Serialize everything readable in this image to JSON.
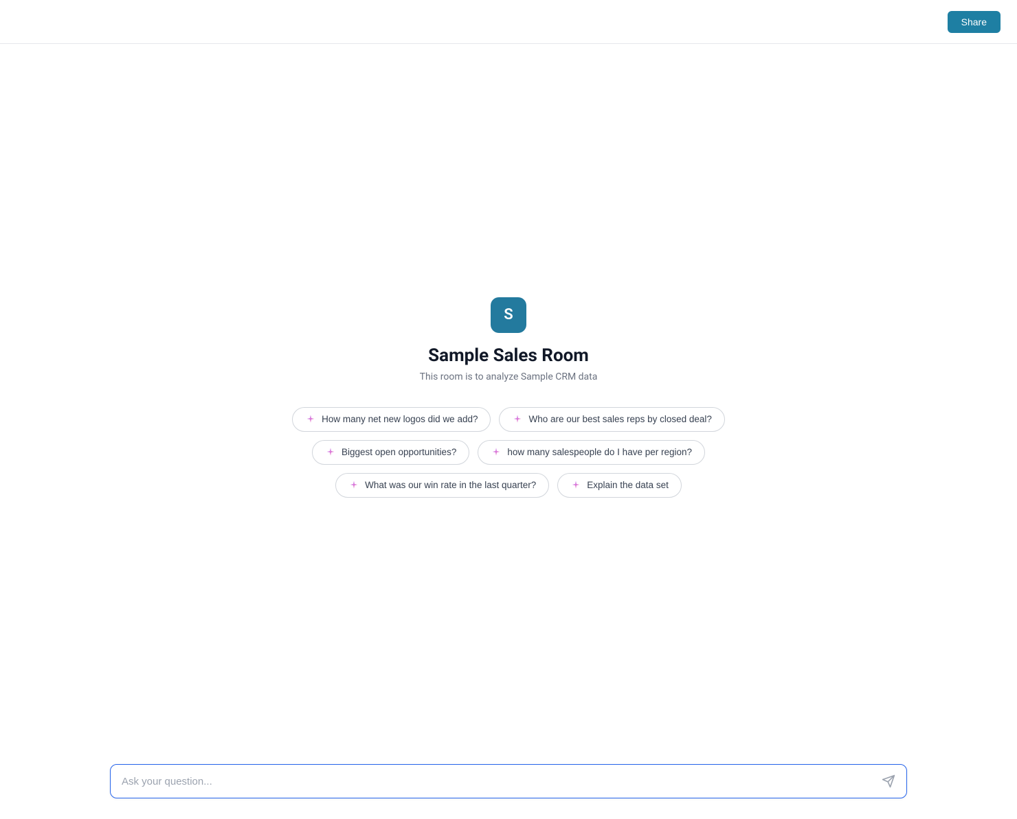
{
  "header": {
    "share_label": "Share"
  },
  "room": {
    "icon_letter": "S",
    "title": "Sample Sales Room",
    "description": "This room is to analyze Sample CRM data"
  },
  "suggestions": {
    "row1": [
      {
        "label": "How many net new logos did we add?"
      },
      {
        "label": "Who are our best sales reps by closed deal?"
      }
    ],
    "row2": [
      {
        "label": "Biggest open opportunities?"
      },
      {
        "label": "how many salespeople do I have per region?"
      }
    ],
    "row3": [
      {
        "label": "What was our win rate in the last quarter?"
      },
      {
        "label": "Explain the data set"
      }
    ]
  },
  "input": {
    "placeholder": "Ask your question..."
  }
}
